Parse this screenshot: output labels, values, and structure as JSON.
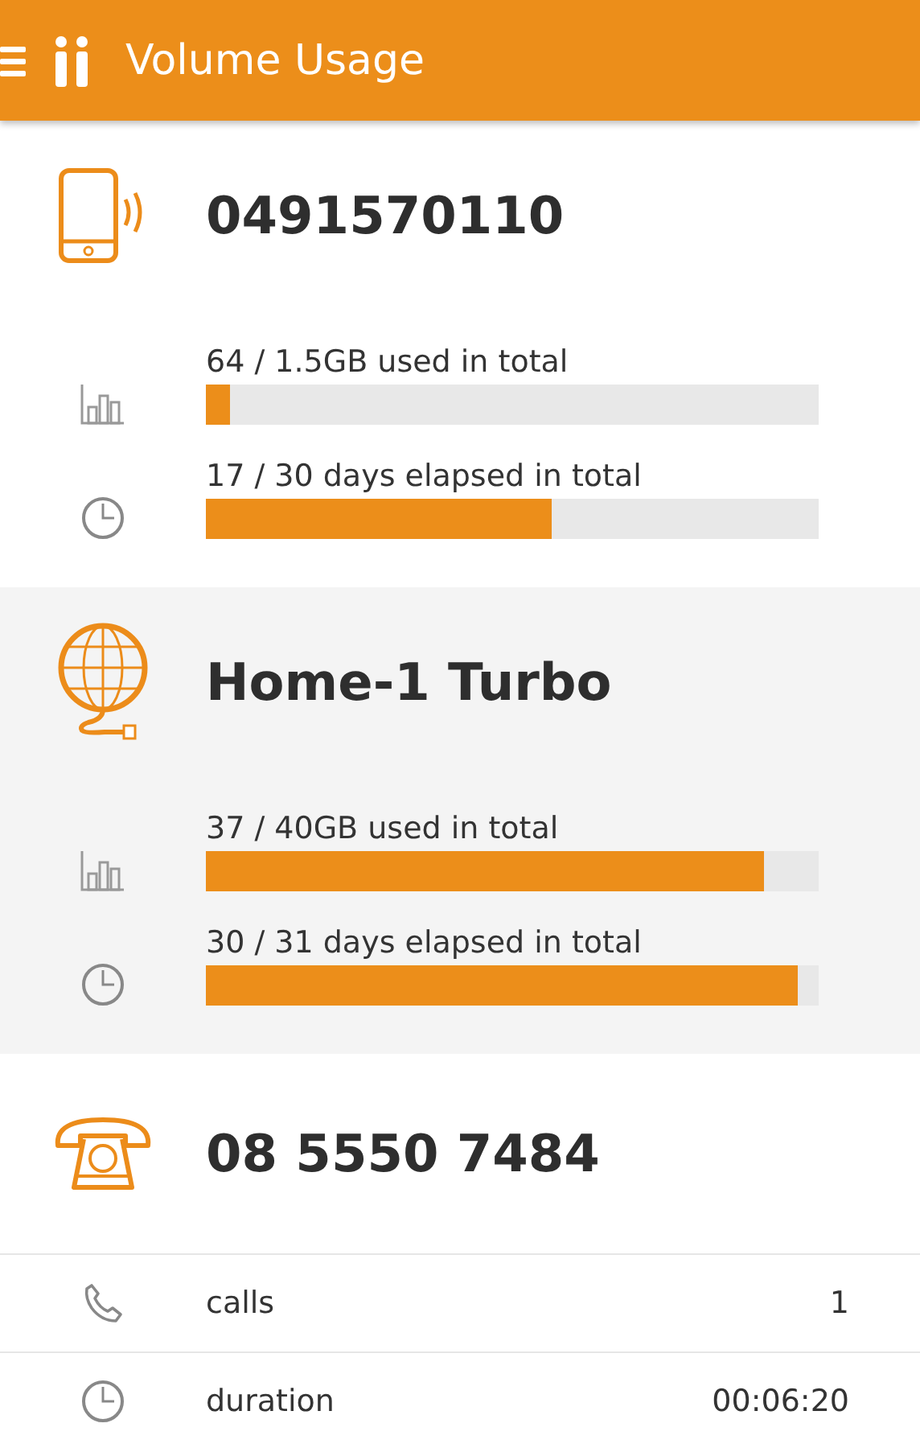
{
  "app_bar": {
    "title": "Volume Usage"
  },
  "services": [
    {
      "kind": "mobile",
      "title": "0491570110",
      "items": [
        {
          "kind": "usage",
          "label": "64 / 1.5GB used in total",
          "level": 0.04
        },
        {
          "kind": "elapsed",
          "label": "17 / 30 days elapsed in total",
          "level": 0.565
        }
      ]
    },
    {
      "kind": "broadband",
      "title": "Home-1 Turbo",
      "items": [
        {
          "kind": "usage",
          "label": "37 / 40GB used in total",
          "level": 0.91
        },
        {
          "kind": "elapsed",
          "label": "30 / 31 days elapsed in total",
          "level": 0.967
        }
      ]
    },
    {
      "kind": "landline",
      "title": "08 5550 7484",
      "items": [
        {
          "kind": "calls",
          "label": "calls",
          "value": "1"
        },
        {
          "kind": "duration",
          "label": "duration",
          "value": "00:06:20"
        }
      ]
    }
  ]
}
